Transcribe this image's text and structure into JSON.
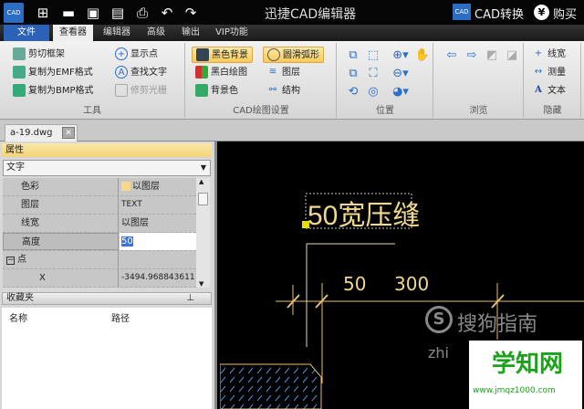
{
  "titlebar": {
    "app_icon": "CAD",
    "title": "迅捷CAD编辑器",
    "convert_icon": "CAD",
    "convert": "CAD转换",
    "buy": "购买",
    "buy_icon": "¥",
    "quick": [
      "new-icon",
      "open-icon",
      "save-icon",
      "save-as-icon",
      "print-icon",
      "undo-icon",
      "redo-icon"
    ]
  },
  "menu": [
    "文件",
    "查看器",
    "编辑器",
    "高级",
    "输出",
    "VIP功能"
  ],
  "ribbon": {
    "tools": {
      "label": "工具",
      "items": [
        "剪切框架",
        "复制为EMF格式",
        "复制为BMP格式",
        "显示点",
        "查找文字",
        "修剪光栅"
      ]
    },
    "cad": {
      "label": "CAD绘图设置",
      "items": [
        "黑色背景",
        "黑白绘图",
        "背景色",
        "圆滑弧形",
        "图层",
        "结构"
      ]
    },
    "position": {
      "label": "位置"
    },
    "browse": {
      "label": "浏览"
    },
    "hide": {
      "label": "隐藏",
      "items": [
        "线宽",
        "测量",
        "文本"
      ]
    }
  },
  "doc_tab": "a-19.dwg",
  "properties": {
    "title": "属性",
    "type": "文字",
    "rows": [
      {
        "k": "色彩",
        "v": "以图层"
      },
      {
        "k": "图层",
        "v": "TEXT"
      },
      {
        "k": "线宽",
        "v": "以图层"
      },
      {
        "k": "高度",
        "v": "50"
      },
      {
        "k": "点",
        "v": ""
      },
      {
        "k": "X",
        "v": "-3494.968843611"
      }
    ]
  },
  "favorites": {
    "title": "收藏夹",
    "col_name": "名称",
    "col_path": "路径"
  },
  "drawing": {
    "text": "50宽压缝",
    "dim1": "50",
    "dim2": "300",
    "accent": "#f0d890"
  },
  "watermarks": {
    "sogou": "搜狗指南",
    "zhi": "zhi",
    "xzw": "学知网",
    "url": "www.jmqz1000.com"
  }
}
